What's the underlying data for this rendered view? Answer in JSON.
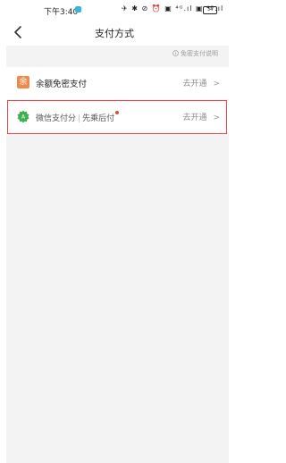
{
  "status_bar": {
    "time": "下午3:40",
    "icons_text": "✈ ✱ ⊘ ⏰ ▣ ⁴ᴳ.ıl ▣ ⁴ᴳ.ıl",
    "battery": "34"
  },
  "header": {
    "title": "支付方式",
    "back_icon": "chevron-left-icon"
  },
  "explain_link": {
    "icon": "info-circle-icon",
    "label": "免密支付说明"
  },
  "methods": [
    {
      "icon_text": "余",
      "label": "余额免密支付",
      "action": "去开通"
    },
    {
      "label_main": "微信支付分",
      "label_sep": "|",
      "label_sub": "先乘后付",
      "action": "去开通",
      "highlighted": true
    }
  ],
  "colors": {
    "background": "#f3f3f3",
    "balance_icon": "#f08a4b",
    "wechat_green": "#3fb050",
    "highlight_border": "#e64545",
    "notice_dot": "#e04b3b"
  }
}
